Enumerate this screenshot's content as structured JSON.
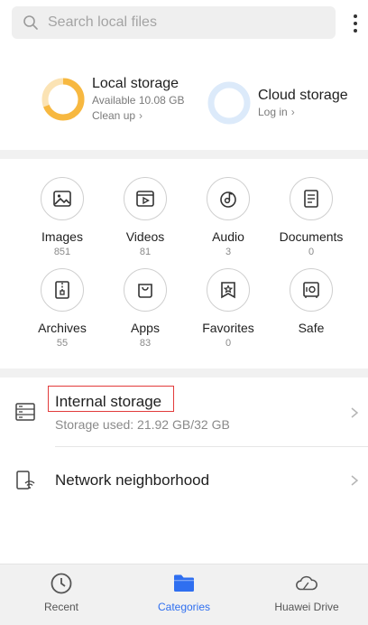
{
  "search": {
    "placeholder": "Search local files"
  },
  "storage": {
    "local": {
      "title": "Local storage",
      "available": "Available 10.08 GB",
      "action": "Clean up",
      "used_fraction": 0.69,
      "ring_color": "#f7b840"
    },
    "cloud": {
      "title": "Cloud storage",
      "action": "Log in",
      "ring_color": "#d9e8f8"
    }
  },
  "categories": [
    {
      "label": "Images",
      "count": "851",
      "icon": "image-icon"
    },
    {
      "label": "Videos",
      "count": "81",
      "icon": "video-icon"
    },
    {
      "label": "Audio",
      "count": "3",
      "icon": "audio-icon"
    },
    {
      "label": "Documents",
      "count": "0",
      "icon": "document-icon"
    },
    {
      "label": "Archives",
      "count": "55",
      "icon": "archive-icon"
    },
    {
      "label": "Apps",
      "count": "83",
      "icon": "apps-icon"
    },
    {
      "label": "Favorites",
      "count": "0",
      "icon": "favorites-icon"
    },
    {
      "label": "Safe",
      "count": "",
      "icon": "safe-icon"
    }
  ],
  "locations": {
    "internal": {
      "title": "Internal storage",
      "sub": "Storage used: 21.92 GB/32 GB"
    },
    "network": {
      "title": "Network neighborhood"
    }
  },
  "nav": {
    "tabs": [
      {
        "label": "Recent",
        "icon": "clock-icon"
      },
      {
        "label": "Categories",
        "icon": "folder-icon",
        "active": true
      },
      {
        "label": "Huawei Drive",
        "icon": "cloud-icon"
      }
    ],
    "accent": "#2f6ff0"
  }
}
